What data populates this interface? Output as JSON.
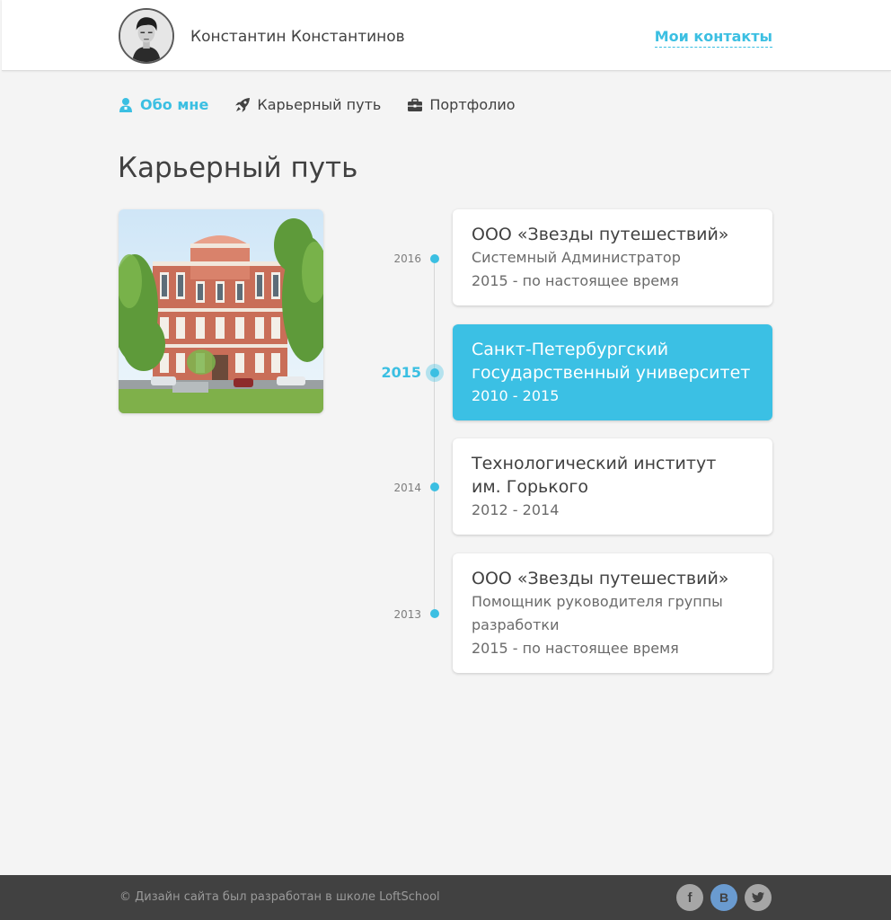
{
  "header": {
    "user_name": "Константин Константинов",
    "avatar_icon": "user-portrait-avatar",
    "contacts_link": "Мои контакты"
  },
  "nav": {
    "items": [
      {
        "label": "Обо мне",
        "icon": "user-icon",
        "active": true
      },
      {
        "label": "Карьерный путь",
        "icon": "rocket-icon",
        "active": false
      },
      {
        "label": "Портфолио",
        "icon": "briefcase-icon",
        "active": false
      }
    ]
  },
  "page": {
    "title": "Карьерный путь",
    "photo": "university-building-photo"
  },
  "timeline": [
    {
      "year": "2016",
      "title": "ООО «Звезды путешествий»",
      "lines": [
        "Системный Администратор",
        "2015 - по настоящее время"
      ],
      "active": false
    },
    {
      "year": "2015",
      "title_lines": [
        "Санкт-Петербургский",
        "государственный университет"
      ],
      "lines": [
        "2010 - 2015"
      ],
      "active": true
    },
    {
      "year": "2014",
      "title_lines": [
        "Технологический институт",
        "им. Горького"
      ],
      "lines": [
        "2012 - 2014"
      ],
      "active": false
    },
    {
      "year": "2013",
      "title": "ООО «Звезды путешествий»",
      "lines": [
        "Помощник руководителя группы",
        "разработки",
        "2015 - по настоящее время"
      ],
      "active": false
    }
  ],
  "footer": {
    "copyright": "© Дизайн сайта был разработан в школе LoftSchool",
    "social": [
      {
        "icon": "facebook-icon",
        "label": "f"
      },
      {
        "icon": "vkontakte-icon",
        "label": "B"
      },
      {
        "icon": "twitter-icon",
        "label": ""
      }
    ]
  },
  "colors": {
    "accent": "#3bbfe2",
    "background": "#f4f4f4",
    "text": "#414141",
    "footer": "#414141"
  }
}
